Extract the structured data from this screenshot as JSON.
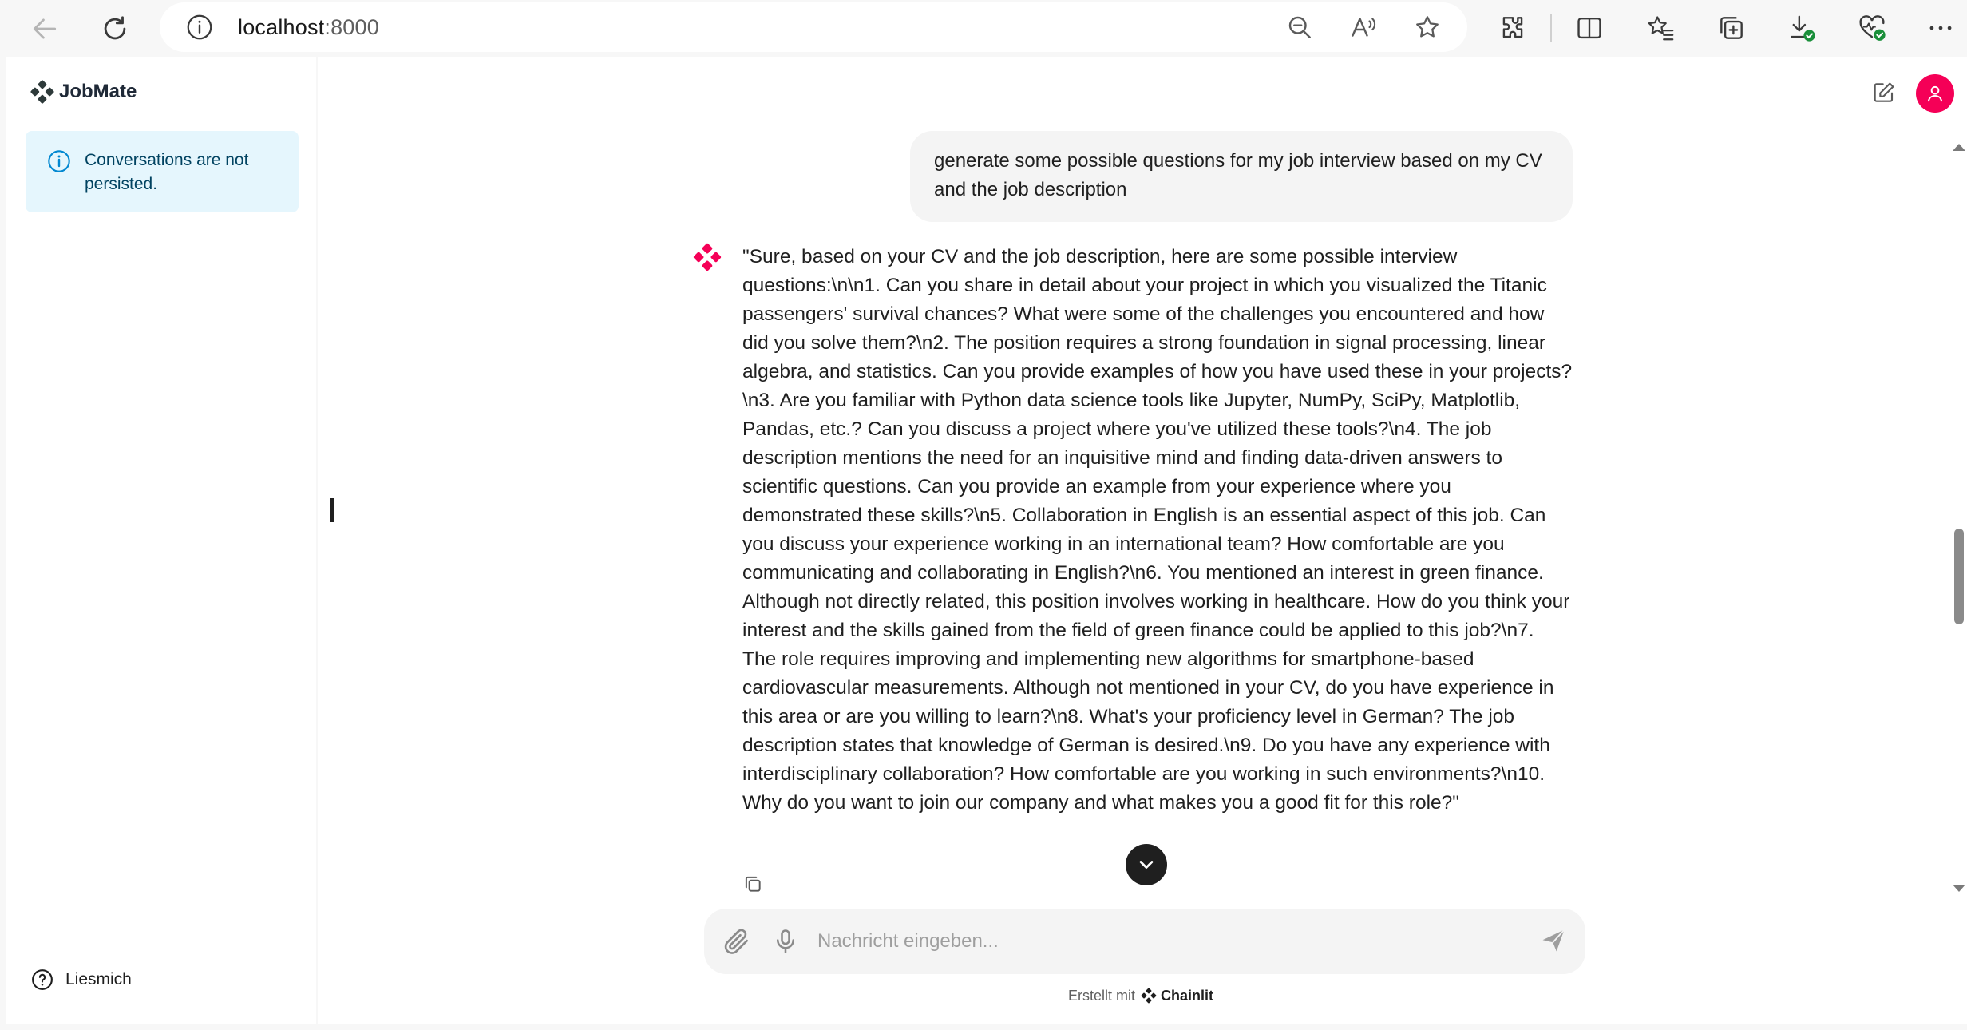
{
  "browser": {
    "url_host": "localhost",
    "url_port": ":8000"
  },
  "sidebar": {
    "app_name": "JobMate",
    "notice": "Conversations are not persisted.",
    "readme_label": "Liesmich"
  },
  "chat": {
    "user_message": "generate some possible questions for my job interview based on my CV and the job description",
    "bot_message": "\"Sure, based on your CV and the job description, here are some possible interview questions:\\n\\n1. Can you share in detail about your project in which you visualized the Titanic passengers' survival chances? What were some of the challenges you encountered and how did you solve them?\\n2. The position requires a strong foundation in signal processing, linear algebra, and statistics. Can you provide examples of how you have used these in your projects?\\n3. Are you familiar with Python data science tools like Jupyter, NumPy, SciPy, Matplotlib, Pandas, etc.? Can you discuss a project where you've utilized these tools?\\n4. The job description mentions the need for an inquisitive mind and finding data-driven answers to scientific questions. Can you provide an example from your experience where you demonstrated these skills?\\n5. Collaboration in English is an essential aspect of this job. Can you discuss your experience working in an international team? How comfortable are you communicating and collaborating in English?\\n6. You mentioned an interest in green finance. Although not directly related, this position involves working in healthcare. How do you think your interest and the skills gained from the field of green finance could be applied to this job?\\n7. The role requires improving and implementing new algorithms for smartphone-based cardiovascular measurements. Although not mentioned in your CV, do you have experience in this area or are you willing to learn?\\n8. What's your proficiency level in German? The job description states that knowledge of German is desired.\\n9. Do you have any experience with interdisciplinary collaboration? How comfortable are you working in such environments?\\n10. Why do you want to join our company and what makes you a good fit for this role?\""
  },
  "composer": {
    "placeholder": "Nachricht eingeben..."
  },
  "footer": {
    "prefix": "Erstellt mit",
    "brand": "Chainlit"
  },
  "colors": {
    "accent": "#f50057",
    "info_bg": "#e5f6fd",
    "info_text": "#014361",
    "info_icon": "#0288d1"
  },
  "icons": [
    "back-arrow-icon",
    "refresh-icon",
    "info-icon",
    "zoom-out-icon",
    "read-aloud-icon",
    "favorite-star-icon",
    "extensions-icon",
    "split-screen-icon",
    "favorites-icon",
    "collections-icon",
    "downloads-icon",
    "browser-essentials-icon",
    "more-icon",
    "chainlit-logo-icon",
    "help-circle-icon",
    "edit-icon",
    "user-icon",
    "bot-avatar-icon",
    "copy-icon",
    "chevron-down-icon",
    "paperclip-icon",
    "microphone-icon",
    "send-icon"
  ]
}
